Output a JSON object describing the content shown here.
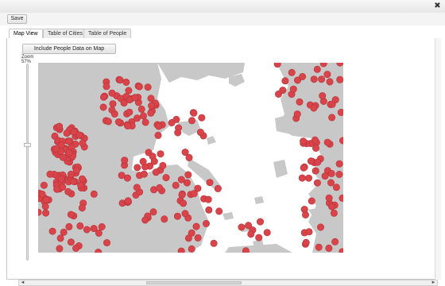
{
  "window": {
    "close_glyph": "✖"
  },
  "toolbar": {
    "save_label": "Save"
  },
  "tabs": [
    {
      "label": "Map View",
      "active": true
    },
    {
      "label": "Table of Cities",
      "active": false
    },
    {
      "label": "Table of People",
      "active": false
    }
  ],
  "map_view": {
    "include_people_label": "Include People Data on Map",
    "zoom_label": "Zoom",
    "zoom_value": "57%",
    "zoom_slider_level": 0.41,
    "land_color": "#c8c8c8",
    "water_color": "#ffffff",
    "marker_color": "#d9444a",
    "marker_icon": "red-circle-marker"
  },
  "scrollbar": {
    "left_arrow": "◄",
    "right_arrow": "►"
  }
}
